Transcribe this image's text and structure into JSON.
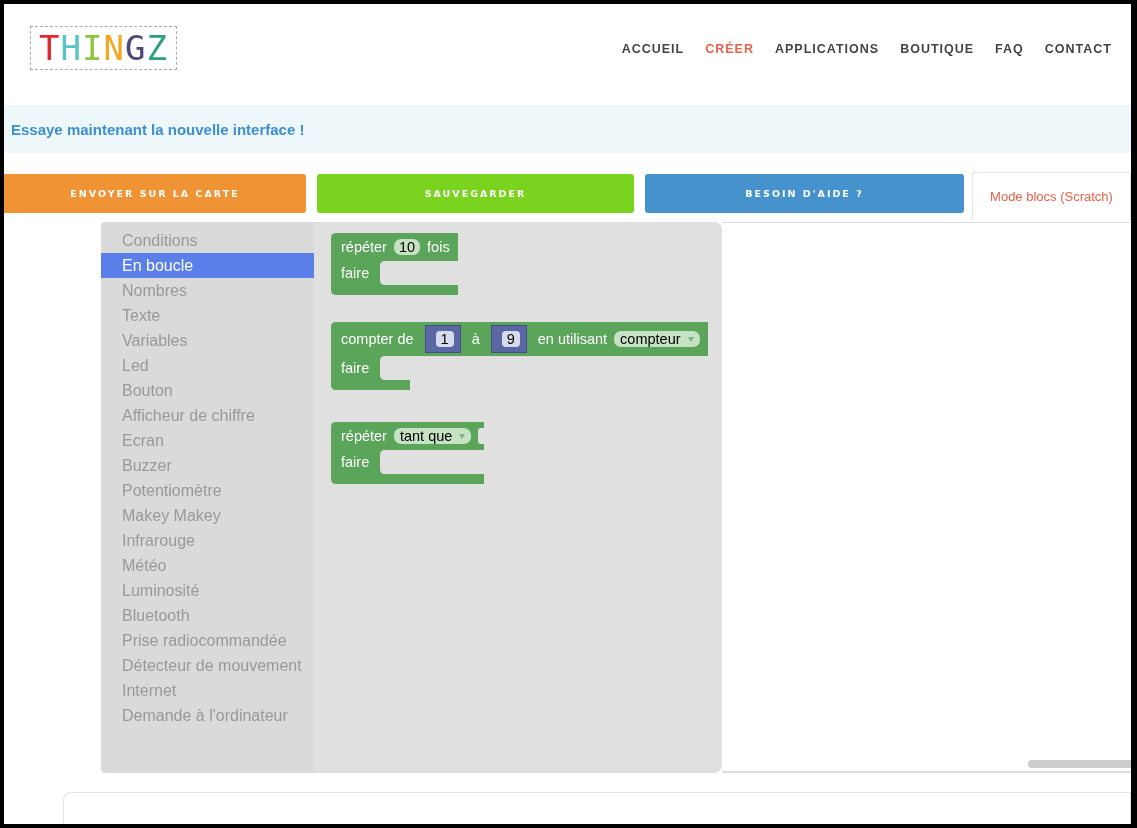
{
  "logo": {
    "text": "THINGZ"
  },
  "nav": [
    {
      "label": "ACCUEIL",
      "selected": false
    },
    {
      "label": "CRÉER",
      "selected": true
    },
    {
      "label": "APPLICATIONS",
      "selected": false
    },
    {
      "label": "BOUTIQUE",
      "selected": false
    },
    {
      "label": "FAQ",
      "selected": false
    },
    {
      "label": "CONTACT",
      "selected": false
    }
  ],
  "banner": {
    "text": "Essaye maintenant la nouvelle interface !"
  },
  "actions": [
    {
      "label": "ENVOYER SUR LA CARTE",
      "color": "#ef9334"
    },
    {
      "label": "SAUVEGARDER",
      "color": "#7ad31e"
    },
    {
      "label": "BESOIN D'AIDE ?",
      "color": "#4592cc"
    }
  ],
  "tab": {
    "label": "Mode blocs (Scratch)",
    "selected": true
  },
  "toolbox": {
    "categories": [
      {
        "label": "Conditions",
        "selected": false
      },
      {
        "label": "En boucle",
        "selected": true
      },
      {
        "label": "Nombres",
        "selected": false
      },
      {
        "label": "Texte",
        "selected": false
      },
      {
        "label": "Variables",
        "selected": false
      },
      {
        "label": "Led",
        "selected": false
      },
      {
        "label": "Bouton",
        "selected": false
      },
      {
        "label": "Afficheur de chiffre",
        "selected": false
      },
      {
        "label": "Ecran",
        "selected": false
      },
      {
        "label": "Buzzer",
        "selected": false
      },
      {
        "label": "Potentiomètre",
        "selected": false
      },
      {
        "label": "Makey Makey",
        "selected": false
      },
      {
        "label": "Infrarouge",
        "selected": false
      },
      {
        "label": "Météo",
        "selected": false
      },
      {
        "label": "Luminosité",
        "selected": false
      },
      {
        "label": "Bluetooth",
        "selected": false
      },
      {
        "label": "Prise radiocommandée",
        "selected": false
      },
      {
        "label": "Détecteur de mouvement",
        "selected": false
      },
      {
        "label": "Internet",
        "selected": false
      },
      {
        "label": "Demande à l'ordinateur",
        "selected": false
      }
    ]
  },
  "flyout": {
    "blocks": [
      {
        "header": [
          {
            "kind": "text",
            "text": "répéter"
          },
          {
            "kind": "number",
            "text": "10"
          },
          {
            "kind": "text",
            "text": "fois"
          }
        ],
        "body_label": "faire"
      },
      {
        "header": [
          {
            "kind": "text",
            "text": "compter de"
          },
          {
            "kind": "value",
            "text": "1"
          },
          {
            "kind": "text",
            "text": "à"
          },
          {
            "kind": "value",
            "text": "9"
          },
          {
            "kind": "text",
            "text": "en utilisant"
          },
          {
            "kind": "dropdown",
            "text": "compteur"
          }
        ],
        "body_label": "faire"
      },
      {
        "header": [
          {
            "kind": "text",
            "text": "répéter"
          },
          {
            "kind": "dropdown",
            "text": "tant que"
          },
          {
            "kind": "socket"
          }
        ],
        "body_label": "faire"
      }
    ]
  }
}
